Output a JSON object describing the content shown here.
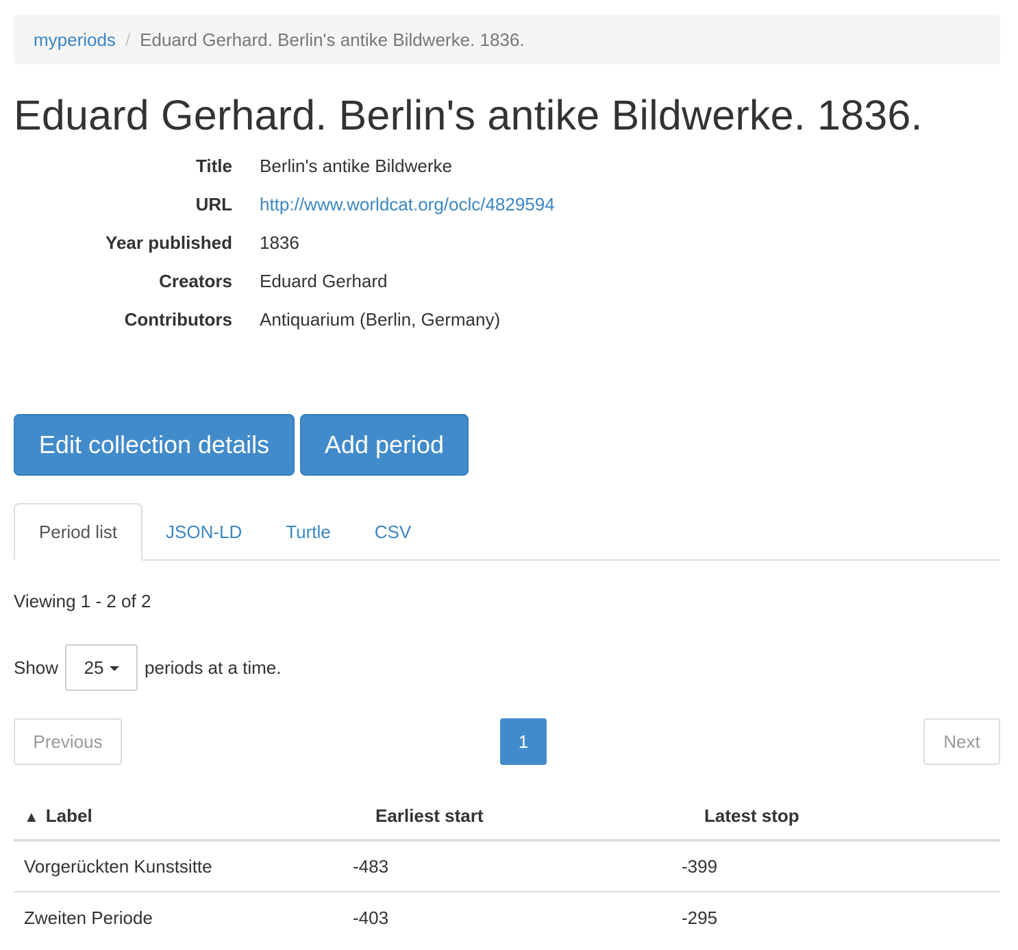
{
  "breadcrumb": {
    "root": "myperiods",
    "separator": "/",
    "current": "Eduard Gerhard. Berlin's antike Bildwerke. 1836."
  },
  "page_title": "Eduard Gerhard. Berlin's antike Bildwerke. 1836.",
  "details": [
    {
      "label": "Title",
      "value": "Berlin's antike Bildwerke"
    },
    {
      "label": "URL",
      "value": "http://www.worldcat.org/oclc/4829594"
    },
    {
      "label": "Year published",
      "value": "1836"
    },
    {
      "label": "Creators",
      "value": "Eduard Gerhard"
    },
    {
      "label": "Contributors",
      "value": "Antiquarium (Berlin, Germany)"
    }
  ],
  "actions": {
    "edit_label": "Edit collection details",
    "add_label": "Add period"
  },
  "tabs": [
    {
      "label": "Period list",
      "active": true
    },
    {
      "label": "JSON-LD",
      "active": false
    },
    {
      "label": "Turtle",
      "active": false
    },
    {
      "label": "CSV",
      "active": false
    }
  ],
  "viewing_text": "Viewing 1 - 2 of 2",
  "show": {
    "prefix": "Show",
    "value": "25",
    "suffix": "periods at a time."
  },
  "pagination": {
    "previous": "Previous",
    "current_page": "1",
    "next": "Next"
  },
  "table": {
    "sort_icon": "▲",
    "headers": {
      "label": "Label",
      "earliest_start": "Earliest start",
      "latest_stop": "Latest stop"
    },
    "rows": [
      {
        "label": "Vorgerückten Kunstsitte",
        "earliest_start": "-483",
        "latest_stop": "-399"
      },
      {
        "label": "Zweiten Periode",
        "earliest_start": "-403",
        "latest_stop": "-295"
      }
    ]
  },
  "colors": {
    "primary": "#428bca",
    "link": "#3a86c6",
    "breadcrumb_bg": "#f5f5f5",
    "muted": "#777777"
  }
}
